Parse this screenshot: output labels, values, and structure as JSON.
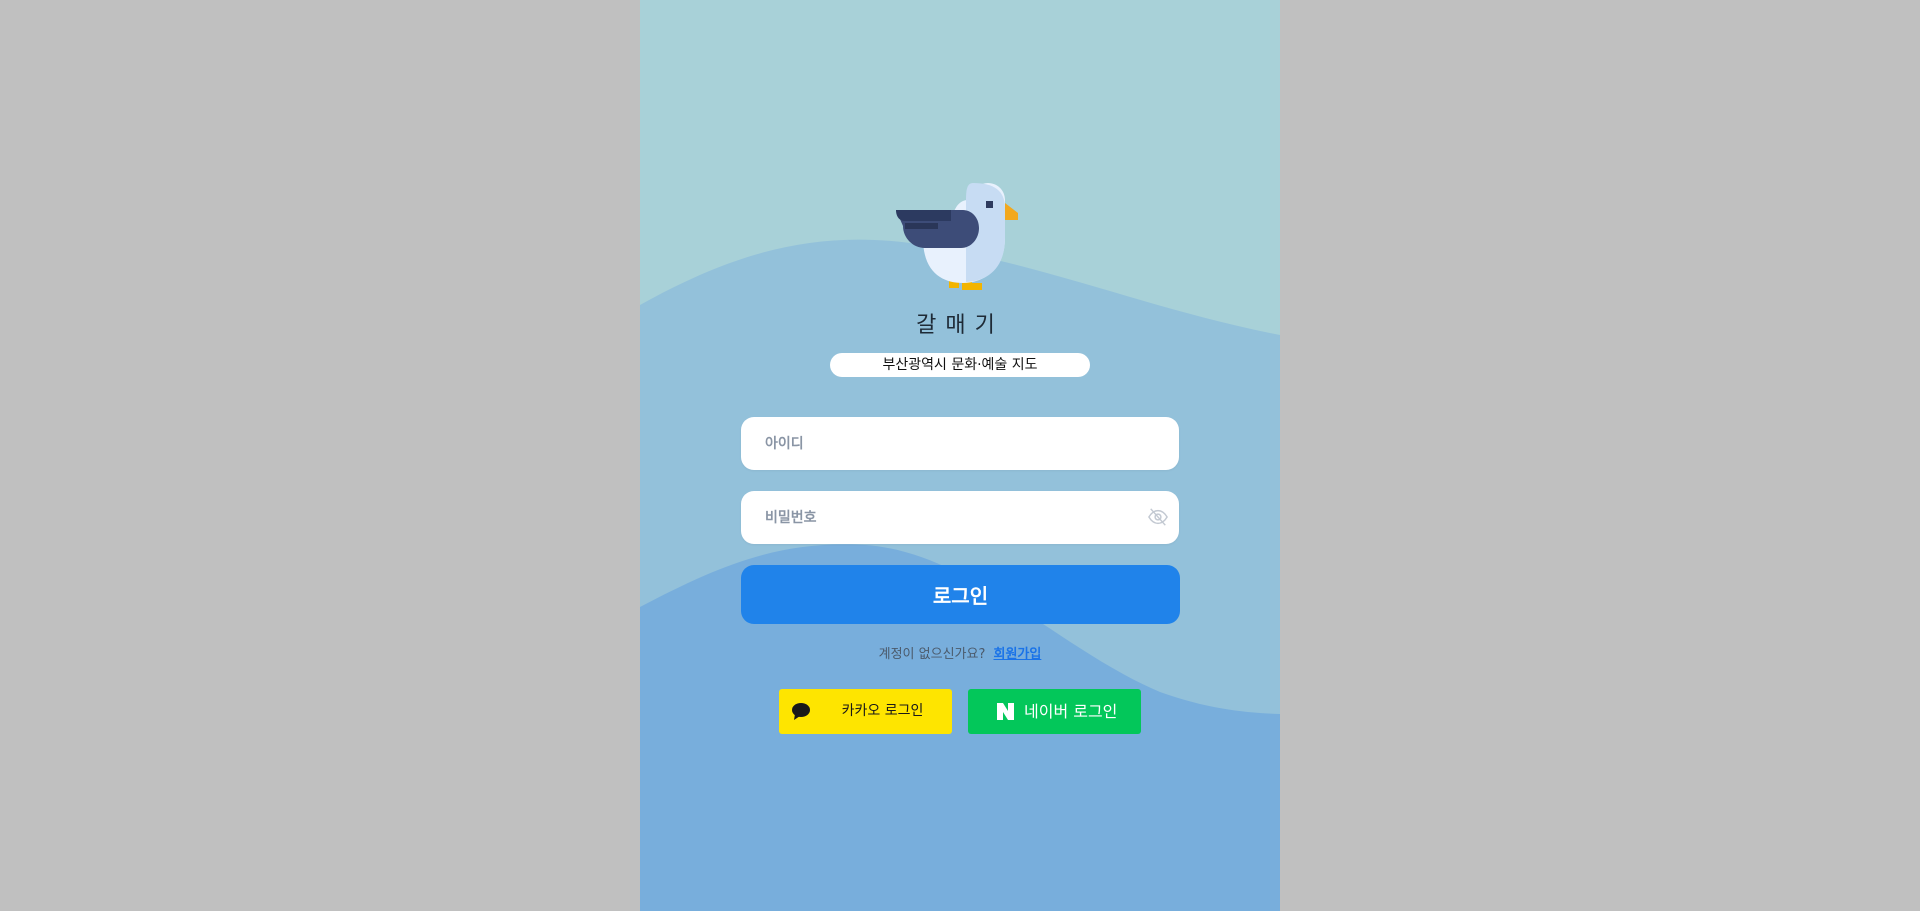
{
  "app": {
    "title": "갈매기",
    "subtitle": "부산광역시 문화·예술 지도"
  },
  "login_form": {
    "id_placeholder": "아이디",
    "password_placeholder": "비밀번호",
    "login_label": "로그인"
  },
  "signup": {
    "prompt": "계정이 없으신가요?",
    "link_label": "회원가입"
  },
  "social": {
    "kakao_label": "카카오 로그인",
    "naver_label": "네이버 로그인"
  },
  "icons": {
    "logo": "seagull-logo",
    "password_toggle": "eye-slash-icon",
    "kakao": "speech-bubble-icon",
    "naver": "naver-n-icon"
  },
  "colors": {
    "page_background": "#c0c0c0",
    "app_background": "#a8d1d8",
    "wave_middle": "#93c1da",
    "wave_front": "#78aedc",
    "primary": "#2083ea",
    "kakao": "#fee500",
    "naver": "#03c75a",
    "link": "#1a73e8"
  }
}
